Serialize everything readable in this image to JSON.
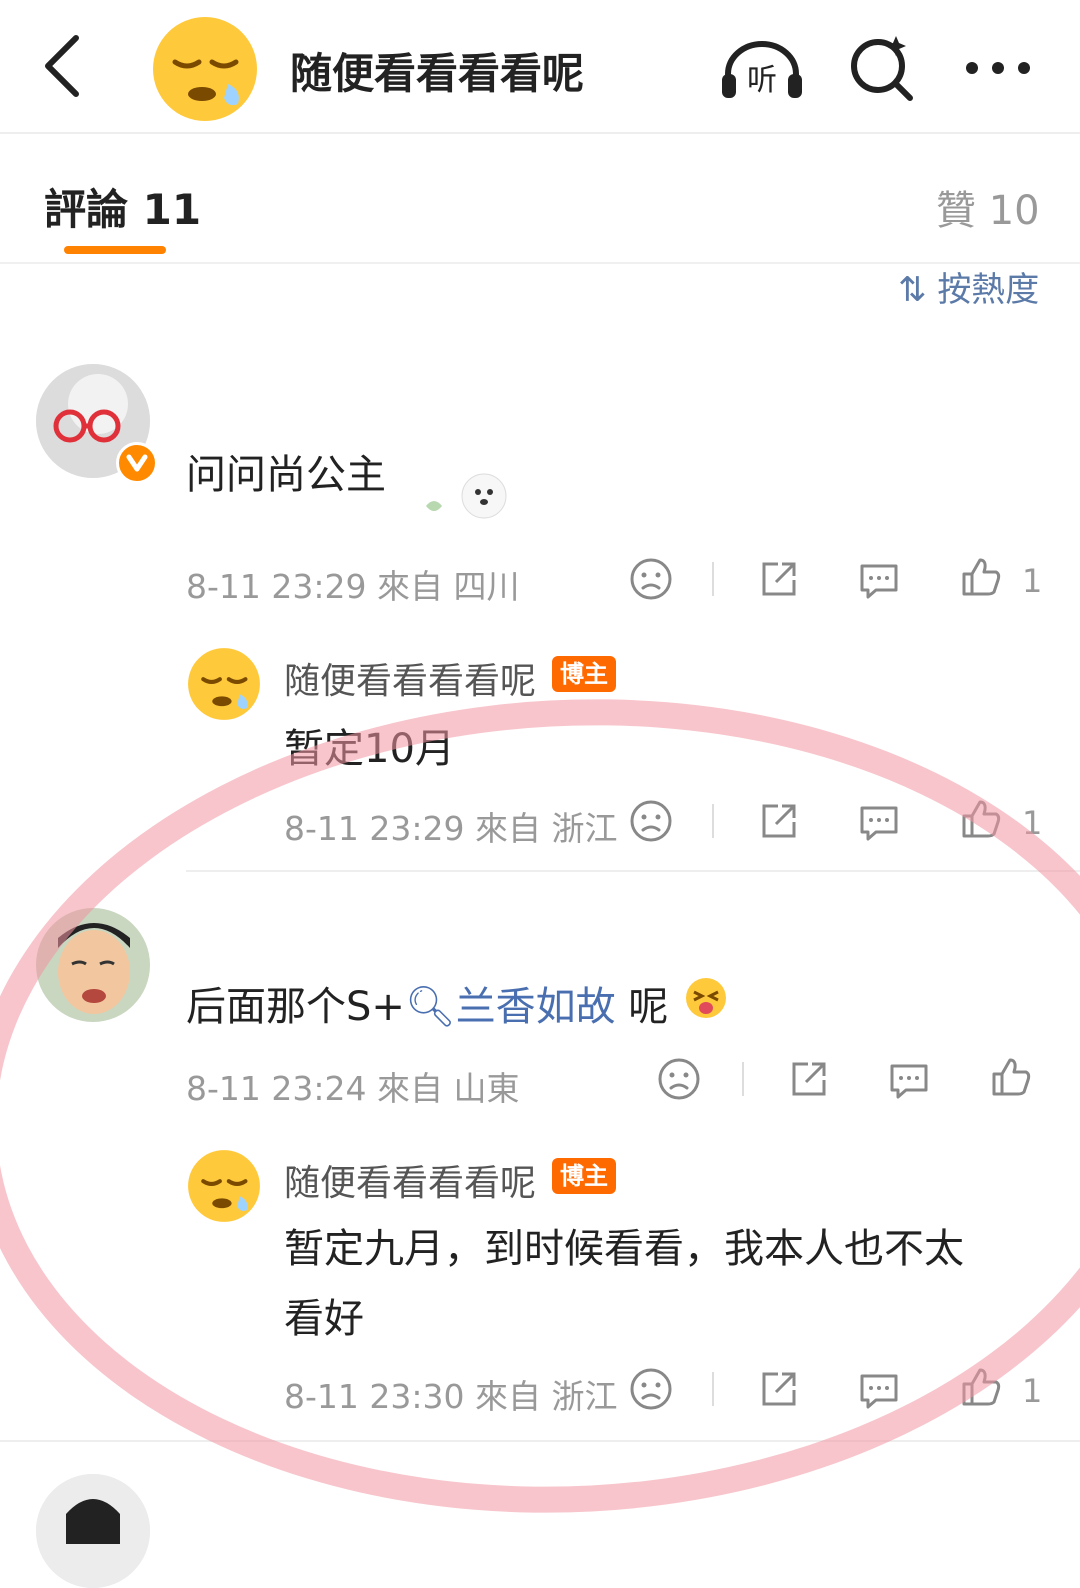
{
  "header": {
    "title": "随便看看看看呢",
    "icons": [
      "back-arrow-icon",
      "sleepy-emoji-avatar",
      "listen-headphones-icon",
      "ai-search-icon",
      "more-dots-icon"
    ],
    "listen_label": "听"
  },
  "tabs": {
    "comments_label": "評論",
    "comments_count": "11",
    "likes_label": "贊",
    "likes_count": "10",
    "sort_label": "按熱度"
  },
  "comments": [
    {
      "text": "问问尚公主",
      "time": "8-11 23:29",
      "from": "來自 四川",
      "like_count": "1",
      "reply": {
        "name": "随便看看看看呢",
        "badge": "博主",
        "text": "暂定10月",
        "time": "8-11 23:29",
        "from": "來自 浙江",
        "like_count": "1"
      }
    },
    {
      "text_before": "后面那个S+",
      "topic": "兰香如故",
      "text_after": " 呢",
      "time": "8-11 23:24",
      "from": "來自 山東",
      "like_count": "",
      "reply": {
        "name": "随便看看看看呢",
        "badge": "博主",
        "text_line1": "暂定九月，到时候看看，我本人也不太",
        "text_line2": "看好",
        "time": "8-11 23:30",
        "from": "來自 浙江",
        "like_count": "1"
      }
    }
  ],
  "colors": {
    "accent": "#ff8200",
    "badge": "#ff6a00",
    "link": "#4a6fb0",
    "annotation_circle": "#f096a0"
  }
}
